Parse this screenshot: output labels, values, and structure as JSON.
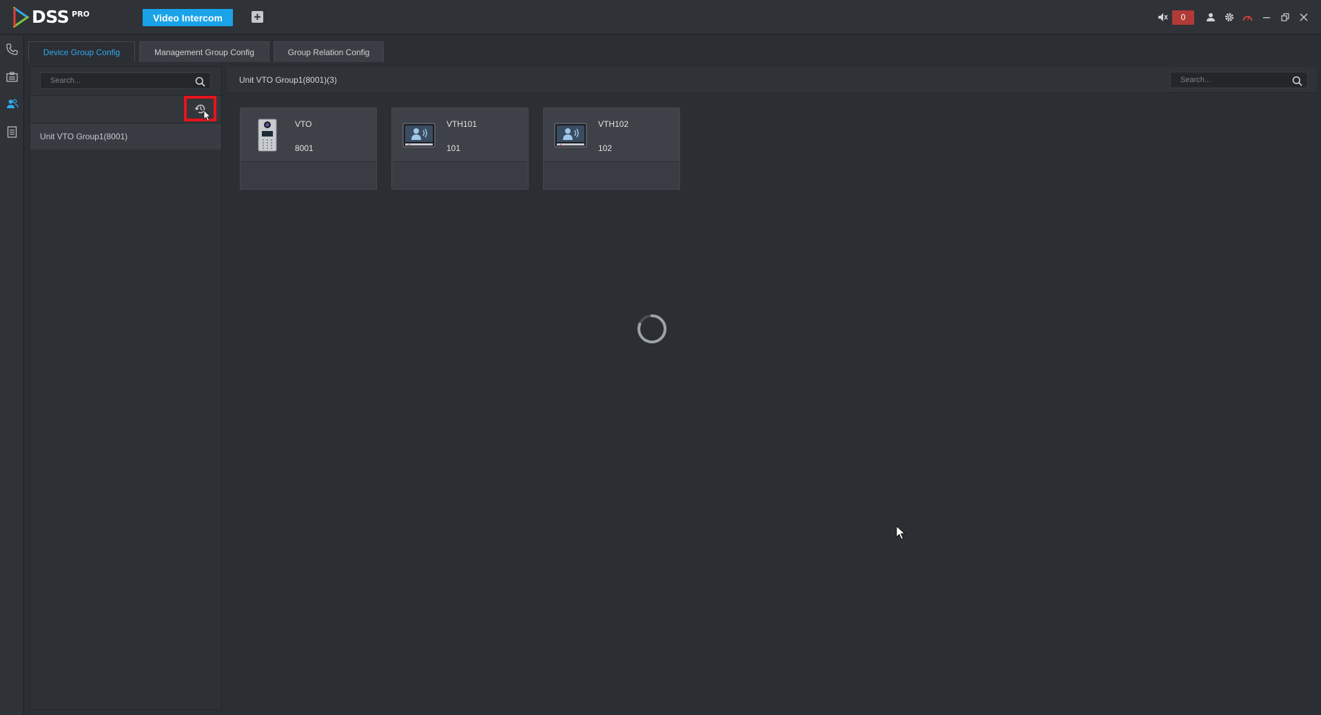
{
  "app": {
    "logo_text": "DSS",
    "logo_suffix": "PRO",
    "module_tab": "Video Intercom",
    "alarm_count": "0"
  },
  "icons": {
    "add_tab": "plus-icon",
    "volume": "speaker-muted-icon",
    "user": "user-icon",
    "settings": "gear-icon",
    "status": "gauge-icon",
    "minimize": "minimize-icon",
    "restore": "restore-icon",
    "close": "close-icon",
    "rail": [
      "phone-icon",
      "id-card-icon",
      "group-icon",
      "document-icon"
    ]
  },
  "subtabs": [
    {
      "label": "Device Group Config",
      "active": true
    },
    {
      "label": "Management Group Config",
      "active": false
    },
    {
      "label": "Group Relation Config",
      "active": false
    }
  ],
  "tree": {
    "search_placeholder": "Search...",
    "items": [
      "Unit VTO Group1(8001)"
    ]
  },
  "content": {
    "title": "Unit VTO Group1(8001)(3)",
    "search_placeholder": "Search...",
    "devices": [
      {
        "name": "VTO",
        "number": "8001",
        "type": "vto"
      },
      {
        "name": "VTH101",
        "number": "101",
        "type": "vth"
      },
      {
        "name": "VTH102",
        "number": "102",
        "type": "vth"
      }
    ]
  },
  "colors": {
    "accent": "#1aa3e8",
    "active_tab_text": "#2fa9ef",
    "alarm_badge": "#b03a36",
    "annotation": "#e8141b"
  }
}
